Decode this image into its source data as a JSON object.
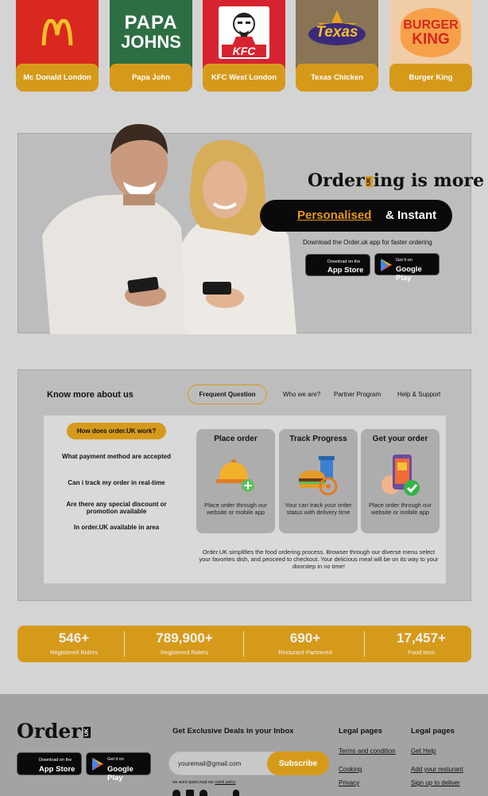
{
  "restaurants": [
    {
      "label": "Mc Donald London",
      "logo": "mcdonalds-logo",
      "color": "#d8281f"
    },
    {
      "label": "Papa John",
      "logo": "papajohns-logo",
      "color": "#2e6e43",
      "logo_text_1": "PAPA",
      "logo_text_2": "JOHNS"
    },
    {
      "label": "KFC West London",
      "logo": "kfc-logo",
      "color": "#d7232f",
      "logo_text": "KFC"
    },
    {
      "label": "Texas Chicken",
      "logo": "texas-chicken-logo",
      "color": "#7a5f3d",
      "logo_text": "Texas"
    },
    {
      "label": "Burger King",
      "logo": "burger-king-logo",
      "color": "#f2c89e",
      "logo_text_1": "BURGER",
      "logo_text_2": "KING"
    }
  ],
  "hero": {
    "headline_start": "Order",
    "headline_badge": "UK",
    "headline_end": "ing is more",
    "highlight": "Personalised",
    "highlight_rest": "& Instant",
    "subtext": "Download the Order.uk app for faster ordering",
    "app_store_small": "Download on the",
    "app_store_big": "App Store",
    "google_small": "Get it on",
    "google_big": "Google Play"
  },
  "know": {
    "title": "Know more about us",
    "tabs": [
      "Frequent Question",
      "Who we are?",
      "Partner Program",
      "Help & Support"
    ],
    "active_tab": "Frequent Question",
    "questions": [
      "How does order.UK work?",
      "What payment method are accepted",
      "Can i track my order in real-time",
      "Are there any special discount or promotion available",
      "In order.UK available in area"
    ],
    "steps": [
      {
        "title": "Place order",
        "desc": "Place order through  our website or mobile app",
        "icon": "cloche-icon"
      },
      {
        "title": "Track Progress",
        "desc": "Your can track your order status with delivery time",
        "icon": "burger-drink-icon"
      },
      {
        "title": "Get your order",
        "desc": "Place order through  our website or mobile app",
        "icon": "phone-check-icon"
      }
    ],
    "summary": "Order.UK simplifies the food ordering process. Browser through our diverse menu select your favorites dish, and peoceed to checkout. Your delicious meal will be on its way to your doorstep in no time!"
  },
  "stats": [
    {
      "num": "546+",
      "label": "Registered Riders"
    },
    {
      "num": "789,900+",
      "label": "Registered Riders"
    },
    {
      "num": "690+",
      "label": "Resturant Partnered"
    },
    {
      "num": "17,457+",
      "label": "Food Item"
    }
  ],
  "footer": {
    "logo": "Order",
    "logo_badge": "UK",
    "deals_title": "Get Exclusive Deals in your Inbox",
    "email_value": "youremail@gmail.com",
    "subscribe": "Subscribe",
    "spam_note": "we wont spam,read our",
    "spam_link": "eamil policy",
    "legal_title_1": "Legal pages",
    "legal_links_1": [
      "Terms and condition",
      "Cooking",
      "Privacy"
    ],
    "legal_title_2": "Legal pages",
    "legal_links_2": [
      "Get Help",
      "Add your resturant",
      "Sign up to deliver"
    ],
    "app_store_small": "Download on the",
    "app_store_big": "App Store",
    "google_small": "Get it on",
    "google_big": "Google Play"
  },
  "colors": {
    "accent": "#d69a1b",
    "accent_text": "#e59a13",
    "dark": "#0a0a0a"
  }
}
